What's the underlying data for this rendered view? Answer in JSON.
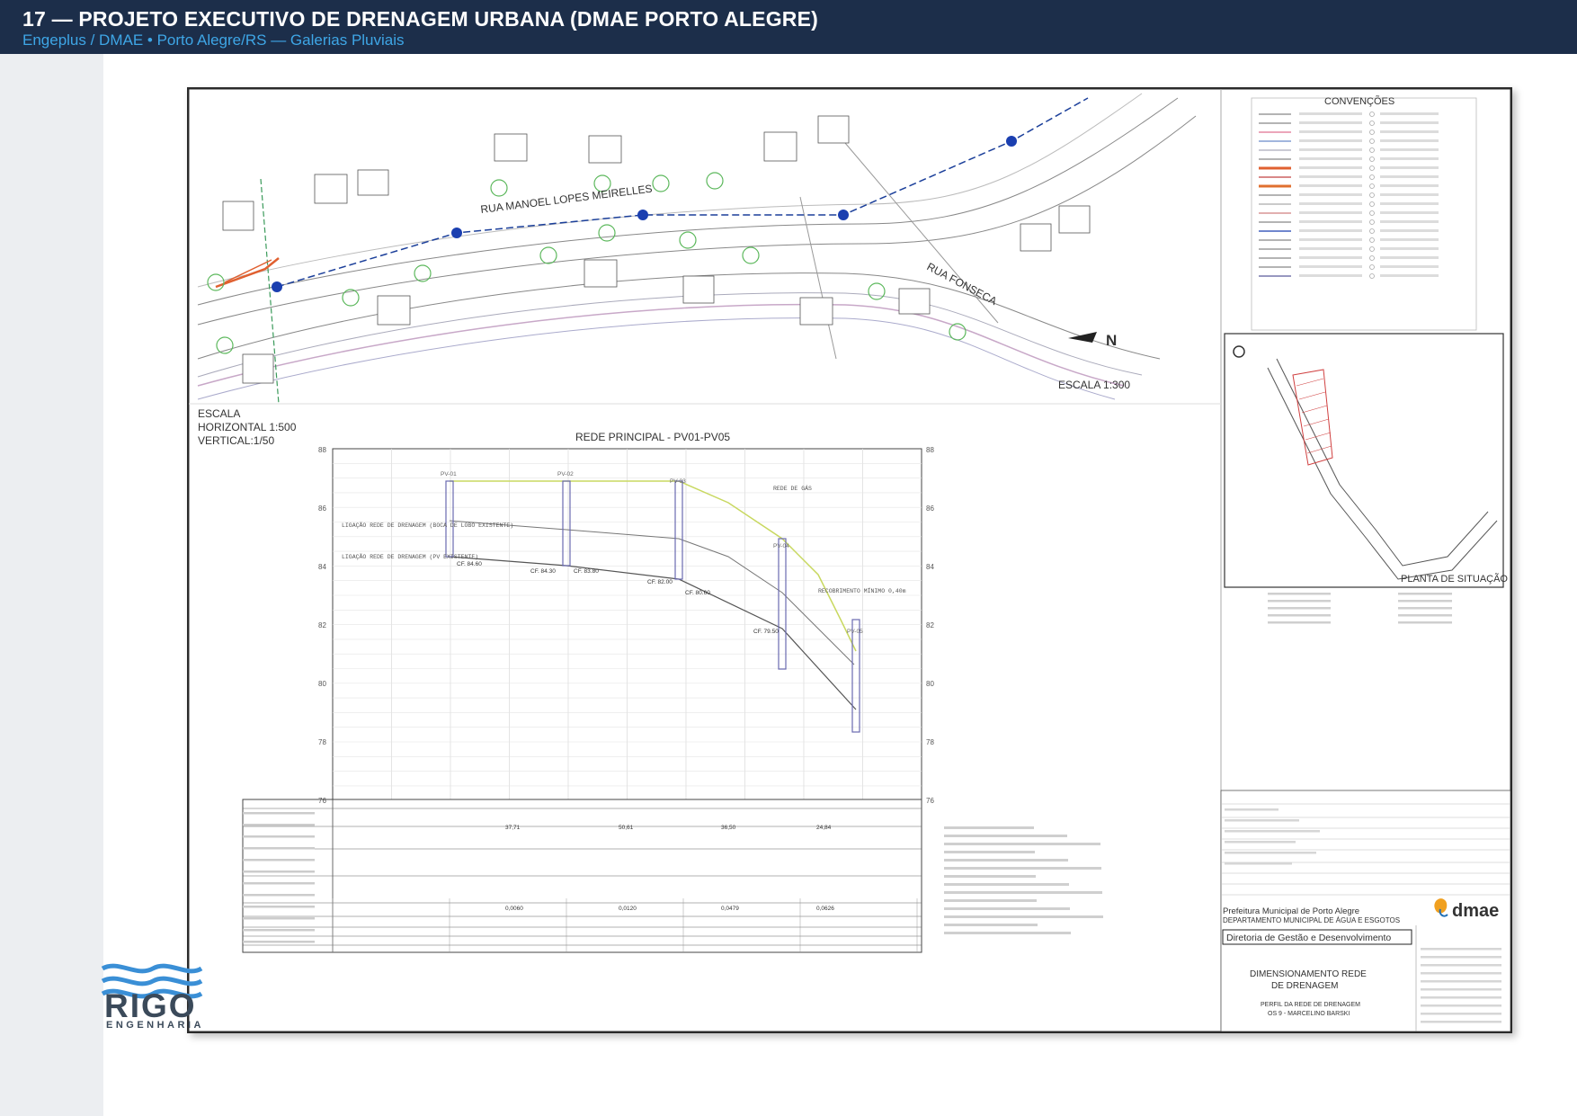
{
  "slide": {
    "title": "17 — PROJETO EXECUTIVO DE DRENAGEM URBANA (DMAE PORTO ALEGRE)",
    "subtitle": "Engeplus / DMAE • Porto Alegre/RS — Galerias Pluviais"
  },
  "plan": {
    "street_1": "RUA MANOEL LOPES MEIRELLES",
    "street_2": "RUA FONSECA",
    "scale": "ESCALA 1:300",
    "north": "N"
  },
  "legend": {
    "title": "CONVENÇÕES"
  },
  "location_map": {
    "title": "PLANTA DE SITUAÇÃO"
  },
  "profile": {
    "scale_title": "ESCALA",
    "scale_h": "HORIZONTAL 1:500",
    "scale_v": "VERTICAL:1/50",
    "title": "REDE PRINCIPAL - PV01-PV05",
    "elev_labels": [
      "88",
      "86",
      "84",
      "82",
      "80",
      "78",
      "76"
    ],
    "pv_labels": [
      "PV-01",
      "PV-02",
      "PV-03",
      "PV-04",
      "PV-05"
    ],
    "cf_labels": [
      "CF. 84.60",
      "CF. 84.30",
      "CF. 83.80",
      "CF. 82.00",
      "CF. 80.60",
      "CF. 79.50"
    ],
    "note_1": "LIGAÇÃO REDE DE DRENAGEM (BOCA DE LOBO EXISTENTE)",
    "note_2": "LIGAÇÃO REDE DE DRENAGEM (PV EXISTENTE)",
    "note_3": "REDE DE GÁS",
    "note_4": "RECOBRIMENTO MÍNIMO 0,40m",
    "row_values": [
      "37,71",
      "50,61",
      "36,50",
      "24,84"
    ],
    "slope_values": [
      "0,0060",
      "0,0120",
      "0,0479",
      "0,0626"
    ]
  },
  "title_block": {
    "org_1": "Prefeitura Municipal de Porto Alegre",
    "org_2": "DEPARTAMENTO MUNICIPAL DE ÁGUA E ESGOTOS",
    "brand": "dmae",
    "directorate": "Diretoria de Gestão e Desenvolvimento",
    "drawing_title_1": "DIMENSIONAMENTO REDE",
    "drawing_title_2": "DE DRENAGEM",
    "drawing_sub_1": "PERFIL DA REDE DE DRENAGEM",
    "drawing_sub_2": "OS 9 - MARCELINO BARSKI"
  },
  "logo": {
    "name": "RIGO",
    "sub": "ENGENHARIA",
    "color": "#3a8fd6"
  }
}
